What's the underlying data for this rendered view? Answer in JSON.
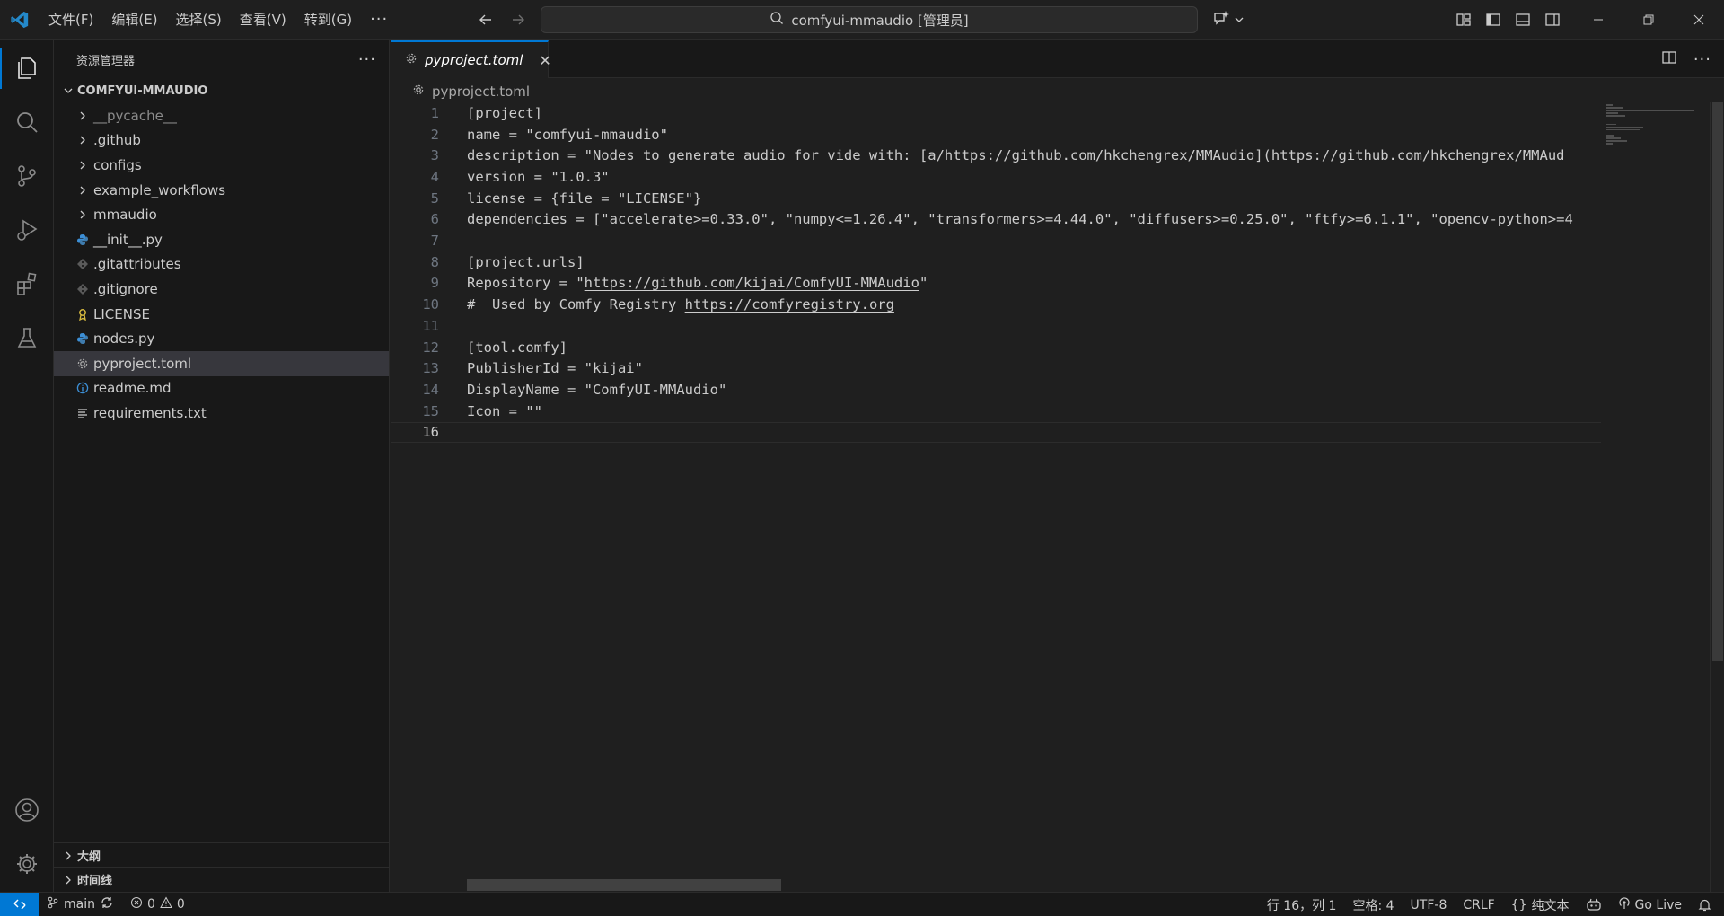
{
  "menu": [
    "文件(F)",
    "编辑(E)",
    "选择(S)",
    "查看(V)",
    "转到(G)"
  ],
  "command_center": {
    "title": "comfyui-mmaudio [管理员]"
  },
  "sidebar": {
    "title": "资源管理器",
    "more": "···",
    "folder": "COMFYUI-MMAUDIO",
    "items": [
      {
        "label": "__pycache__",
        "type": "folder",
        "dim": true
      },
      {
        "label": ".github",
        "type": "folder"
      },
      {
        "label": "configs",
        "type": "folder"
      },
      {
        "label": "example_workflows",
        "type": "folder"
      },
      {
        "label": "mmaudio",
        "type": "folder"
      },
      {
        "label": "__init__.py",
        "type": "python"
      },
      {
        "label": ".gitattributes",
        "type": "git"
      },
      {
        "label": ".gitignore",
        "type": "git"
      },
      {
        "label": "LICENSE",
        "type": "license"
      },
      {
        "label": "nodes.py",
        "type": "python"
      },
      {
        "label": "pyproject.toml",
        "type": "gear",
        "selected": true
      },
      {
        "label": "readme.md",
        "type": "info"
      },
      {
        "label": "requirements.txt",
        "type": "text"
      }
    ],
    "outline": "大纲",
    "timeline": "时间线"
  },
  "editor": {
    "tab": "pyproject.toml",
    "breadcrumb": "pyproject.toml",
    "current_line": 16,
    "lines": [
      "[project]",
      "name = \"comfyui-mmaudio\"",
      "description = \"Nodes to generate audio for vide with: [a/https://github.com/hkchengrex/MMAudio](https://github.com/hkchengrex/MMAud",
      "version = \"1.0.3\"",
      "license = {file = \"LICENSE\"}",
      "dependencies = [\"accelerate>=0.33.0\", \"numpy<=1.26.4\", \"transformers>=4.44.0\", \"diffusers>=0.25.0\", \"ftfy>=6.1.1\", \"opencv-python>=4",
      "",
      "[project.urls]",
      "Repository = \"https://github.com/kijai/ComfyUI-MMAudio\"",
      "#  Used by Comfy Registry https://comfyregistry.org",
      "",
      "[tool.comfy]",
      "PublisherId = \"kijai\"",
      "DisplayName = \"ComfyUI-MMAudio\"",
      "Icon = \"\"",
      ""
    ]
  },
  "status": {
    "branch": "main",
    "errors": "0",
    "warnings": "0",
    "position": "行 16，列 1",
    "spaces": "空格: 4",
    "encoding": "UTF-8",
    "eol": "CRLF",
    "language": "纯文本",
    "golive": "Go Live"
  }
}
